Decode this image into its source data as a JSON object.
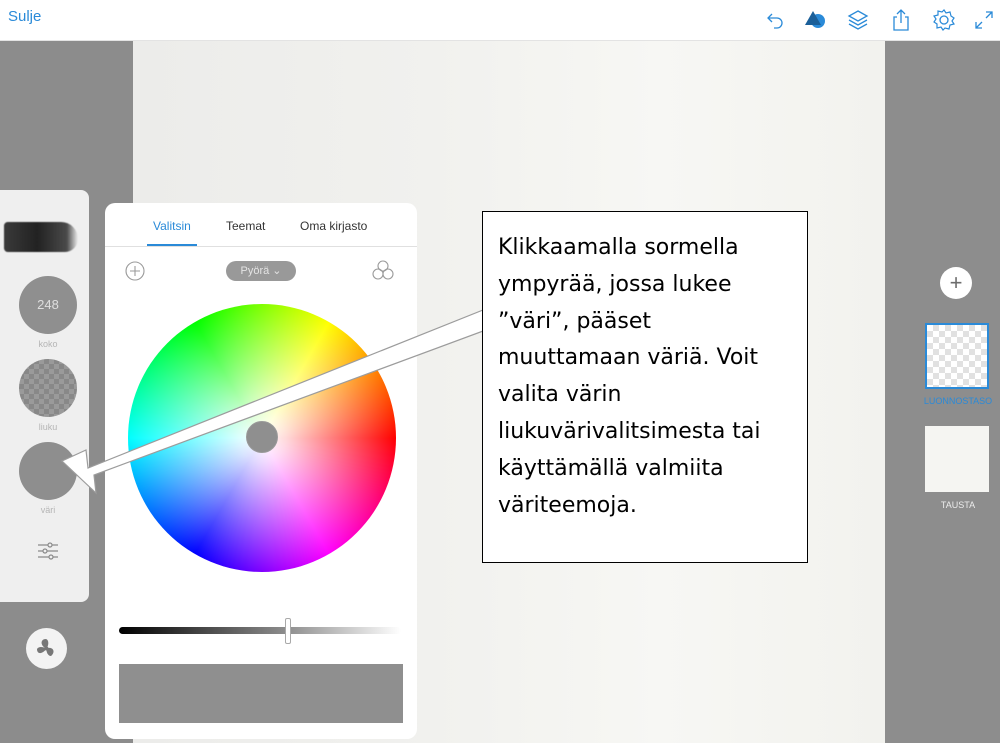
{
  "topbar": {
    "close_label": "Sulje",
    "icons": [
      "undo-icon",
      "shapes-icon",
      "layers-icon",
      "share-icon",
      "settings-icon",
      "expand-icon"
    ]
  },
  "tool_panel": {
    "size_value": "248",
    "size_label": "koko",
    "opacity_label": "liuku",
    "color_label": "väri"
  },
  "color_panel": {
    "tabs": [
      {
        "label": "Valitsin",
        "active": true
      },
      {
        "label": "Teemat",
        "active": false
      },
      {
        "label": "Oma kirjasto",
        "active": false
      }
    ],
    "mode_label": "Pyörä ⌄",
    "current_color": "#8f8f8f",
    "brightness_level": 0.6
  },
  "layers": {
    "sketch_label": "LUONNOSTASO",
    "background_label": "TAUSTA"
  },
  "callout": {
    "text": "Klikkaamalla sormella ympyrää, jossa lukee ”väri”, pääset muuttamaan väriä. Voit valita värin liukuvärivalitsimesta tai käyttämällä valmiita väriteemoja."
  },
  "colors": {
    "accent": "#2a8ad8",
    "frame_gray": "#8c8c8c",
    "canvas": "#f3f3f0"
  }
}
